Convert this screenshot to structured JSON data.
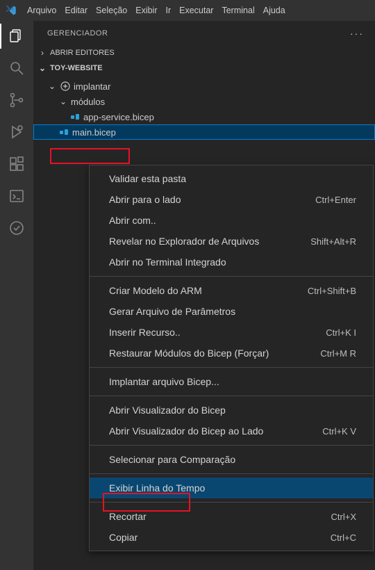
{
  "menubar": {
    "items": [
      "Arquivo",
      "Editar",
      "Seleção",
      "Exibir",
      "Ir",
      "Executar",
      "Terminal",
      "Ajuda"
    ]
  },
  "sidebar": {
    "title": "GERENCIADOR",
    "open_editors": "ABRIR EDITORES",
    "workspace": "TOY-WEBSITE",
    "folder1": "implantar",
    "folder2": "módulos",
    "file1": "app-service.bicep",
    "file2": "main.bicep"
  },
  "context_menu": {
    "groups": [
      [
        {
          "label": "Validar esta pasta",
          "kbd": ""
        },
        {
          "label": "Abrir para o lado",
          "kbd": "Ctrl+Enter"
        },
        {
          "label": "Abrir com..",
          "kbd": ""
        },
        {
          "label": "Revelar no Explorador de Arquivos",
          "kbd": "Shift+Alt+R"
        },
        {
          "label": "Abrir no Terminal Integrado",
          "kbd": ""
        }
      ],
      [
        {
          "label": "Criar Modelo do ARM",
          "kbd": "Ctrl+Shift+B"
        },
        {
          "label": "Gerar Arquivo de Parâmetros",
          "kbd": ""
        },
        {
          "label": "Inserir Recurso..",
          "kbd": "Ctrl+K I"
        },
        {
          "label": "Restaurar Módulos do Bicep (Forçar)",
          "kbd": "Ctrl+M R"
        }
      ],
      [
        {
          "label": "Implantar arquivo Bicep...",
          "kbd": ""
        }
      ],
      [
        {
          "label": "Abrir Visualizador do Bicep",
          "kbd": ""
        },
        {
          "label": "Abrir Visualizador do Bicep ao Lado",
          "kbd": "Ctrl+K V"
        }
      ],
      [
        {
          "label": "Selecionar para Comparação",
          "kbd": ""
        }
      ],
      [
        {
          "label": "Exibir Linha do Tempo",
          "kbd": "",
          "hover": true
        }
      ],
      [
        {
          "label": "Recortar",
          "kbd": "Ctrl+X"
        },
        {
          "label": "Copiar",
          "kbd": "Ctrl+C"
        }
      ]
    ]
  }
}
